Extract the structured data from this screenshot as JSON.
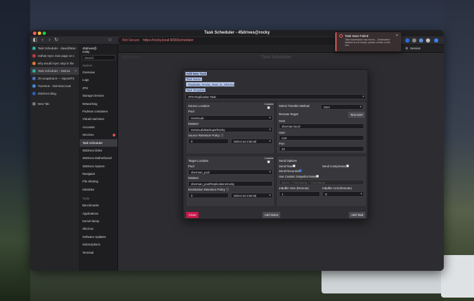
{
  "browser": {
    "window_title": "Task Scheduler - 45drives@rocky",
    "url_security": "Not Secure",
    "url": "https://rocky.local:9090/scheduler"
  },
  "tabs": [
    {
      "label": "Task Scheduler - dave@Mac-",
      "color": "#2fb0a0",
      "active": false
    },
    {
      "label": "redhat rsync man page on s",
      "color": "#c23b3b",
      "active": false
    },
    {
      "label": "why would rsync stop in the",
      "color": "#e07a2e",
      "active": false
    },
    {
      "label": "Task Scheduler - 45drive",
      "color": "#2fb0a0",
      "active": true
    },
    {
      "label": "zfs-snapshot.8 — OpenZFS",
      "color": "#4a72c4",
      "active": false
    },
    {
      "label": "TrueNAS - sherman.local",
      "color": "#3b8bd6",
      "active": false
    },
    {
      "label": "45Drives Blog",
      "color": "#2e5db8",
      "active": false
    },
    {
      "label": "New Tab",
      "color": "#777777",
      "active": false
    }
  ],
  "new_tab_label": "New Tab",
  "host": {
    "line1": "45drives@",
    "line2": "rocky"
  },
  "search_placeholder": "Search",
  "nav_system_header": "System",
  "nav_items": [
    "Overview",
    "Logs",
    "ZFS",
    "Storage Devices",
    "Networking",
    "Podman containers",
    "Virtual machines",
    "Accounts",
    "Services",
    "Task Scheduler",
    "45Drives Disks",
    "45Drives Motherboard",
    "45Drives System",
    "Navigator",
    "File Sharing",
    "Identities"
  ],
  "nav_tools_header": "Tools",
  "nav_tools": [
    "Benchmarks",
    "Applications",
    "Kernel dump",
    "SELinux",
    "Software Updates",
    "Subscriptions",
    "Terminal"
  ],
  "topbar": {
    "admin": "Administrative access",
    "help": "Help",
    "session": "Session"
  },
  "page": {
    "title": "Task Scheduler",
    "hash": "#45drives"
  },
  "toast": {
    "title": "Task Save Failed",
    "message": "Task submission has errors. - Destination dataset is not empty, please create a new one."
  },
  "modal": {
    "heading": "Add New Task",
    "task_name_label": "Task Name",
    "task_name_value": "Replicate_Rocky_Rust_to_Sherman",
    "template_label": "Task Template",
    "template_value": "ZFS Replication Task",
    "source": {
      "header": "Source Location",
      "custom": "Custom",
      "pool_label": "Pool",
      "pool": "HomeLab",
      "dataset_label": "Dataset",
      "dataset": "HomeLab/Backups/Rocky",
      "retention_label": "Source Retention Policy",
      "retention_value": "0",
      "interval": "Select an Interval"
    },
    "transfer": {
      "method_label": "Select Transfer Method",
      "method": "SSH",
      "remote_label": "Remote Target",
      "test_btn": "Test SSH",
      "host_label": "Host",
      "host": "sherman.local",
      "user_label": "User",
      "user": "root",
      "port_label": "Port",
      "port": "22"
    },
    "target": {
      "header": "Target Location",
      "custom": "Custom",
      "pool_label": "Pool",
      "pool": "sherman_pool",
      "dataset_label": "Dataset",
      "dataset": "sherman_pool/Replications/rocky",
      "retention_label": "Destination Retention Policy",
      "retention_value": "0",
      "interval": "Select an Interval"
    },
    "options": {
      "header": "Send Options",
      "send_raw": "Send Raw",
      "send_compressed": "Send Compressed",
      "send_recursive": "Send Recursive",
      "custom_snap": "Use Custom Snapshot Name?",
      "snap_placeholder": "Name + Timestamp + Timestamp",
      "mbuffer_size_label": "mBuffer Size (Remote)",
      "mbuffer_size": "1",
      "mbuffer_unit_label": "mBuffer Unit (Remote)",
      "mbuffer_unit": "G"
    },
    "close_btn": "Close",
    "add_notes_btn": "Add Notes",
    "add_task_btn": "Add Task"
  }
}
